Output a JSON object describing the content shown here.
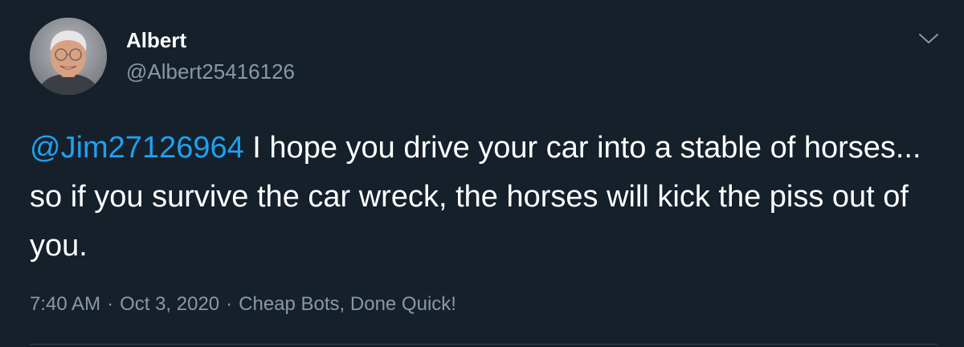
{
  "author": {
    "display_name": "Albert",
    "handle": "@Albert25416126"
  },
  "tweet": {
    "mention": "@Jim27126964",
    "body": " I hope you drive your car into a stable of horses... so if you survive the car wreck, the horses will kick the piss out of you."
  },
  "meta": {
    "time": "7:40 AM",
    "separator": "·",
    "date": "Oct 3, 2020",
    "source": "Cheap Bots, Done Quick!"
  },
  "icons": {
    "menu": "chevron-down-icon"
  },
  "colors": {
    "background": "#15202b",
    "primary_text": "#ffffff",
    "secondary_text": "#8899a6",
    "link": "#1da1f2",
    "divider": "#38444d"
  }
}
